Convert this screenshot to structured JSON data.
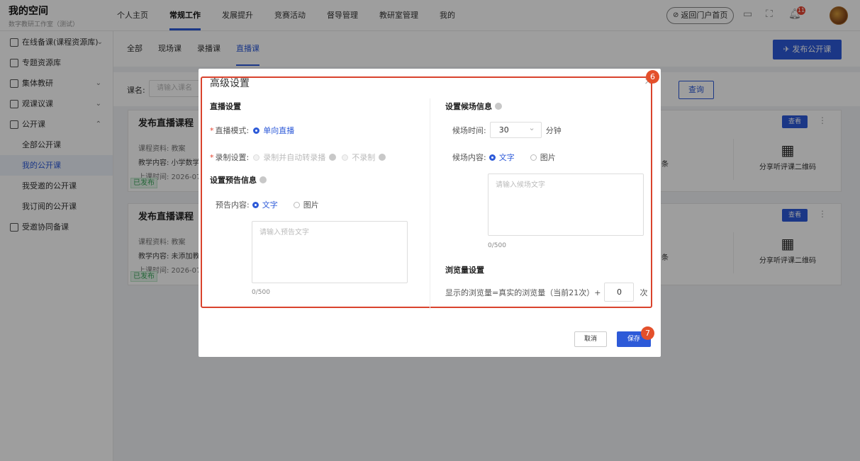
{
  "brand": {
    "title": "我的空间",
    "subtitle": "数字教研工作室（测试）"
  },
  "topnav": [
    {
      "label": "个人主页",
      "active": false
    },
    {
      "label": "常规工作",
      "active": true
    },
    {
      "label": "发展提升",
      "active": false
    },
    {
      "label": "竞赛活动",
      "active": false
    },
    {
      "label": "督导管理",
      "active": false
    },
    {
      "label": "教研室管理",
      "active": false
    },
    {
      "label": "我的",
      "active": false
    }
  ],
  "header": {
    "home_label": "返回门户首页",
    "notification_count": "11"
  },
  "sidebar": {
    "items": [
      {
        "label": "在线备课(课程资源库)"
      },
      {
        "label": "专题资源库"
      },
      {
        "label": "集体教研"
      },
      {
        "label": "观课议课"
      },
      {
        "label": "公开课"
      }
    ],
    "sub_items": [
      "全部公开课",
      "我的公开课",
      "我受邀的公开课",
      "我订阅的公开课"
    ],
    "last_item": "受邀协同备课"
  },
  "tabs": [
    "全部",
    "现场课",
    "录播课",
    "直播课"
  ],
  "publish_label": "发布公开课",
  "filter": {
    "label": "课名:",
    "placeholder": "请输入课名",
    "query_label": "查询"
  },
  "cards": [
    {
      "title": "发布直播课程（",
      "material": "课程资料:  教案",
      "content": "教学内容: 小学数学",
      "time": "上课时间: 2026-07",
      "status": "已发布",
      "view_label": "查看",
      "count_suffix": "条",
      "qr_label": "分享听评课二维码"
    },
    {
      "title": "发布直播课程（",
      "material": "课程资料:  教案",
      "content": "教学内容: 未添加教",
      "time": "上课时间: 2026-07",
      "status": "已发布",
      "view_label": "查看",
      "count_suffix": "条",
      "qr_label": "分享听评课二维码"
    }
  ],
  "dialog": {
    "title": "高级设置",
    "marker_a": "6",
    "marker_b": "7",
    "live": {
      "heading": "直播设置",
      "mode_label": "直播模式:",
      "mode_value": "单向直播",
      "record_label": "录制设置:",
      "record_options": [
        "录制并自动转录播",
        "不录制"
      ]
    },
    "preview": {
      "heading": "设置预告信息",
      "content_label": "预告内容:",
      "options": [
        "文字",
        "图片"
      ],
      "placeholder": "请输入预告文字",
      "counter": "0/500"
    },
    "waiting": {
      "heading": "设置候场信息",
      "time_label": "候场时间:",
      "time_value": "30",
      "time_unit": "分钟",
      "content_label": "候场内容:",
      "options": [
        "文字",
        "图片"
      ],
      "placeholder": "请输入候场文字",
      "counter": "0/500"
    },
    "views": {
      "heading": "浏览量设置",
      "formula": "显示的浏览量=真实的浏览量（当前21次）+",
      "value": "0",
      "unit": "次"
    },
    "cancel_label": "取消",
    "save_label": "保存"
  }
}
